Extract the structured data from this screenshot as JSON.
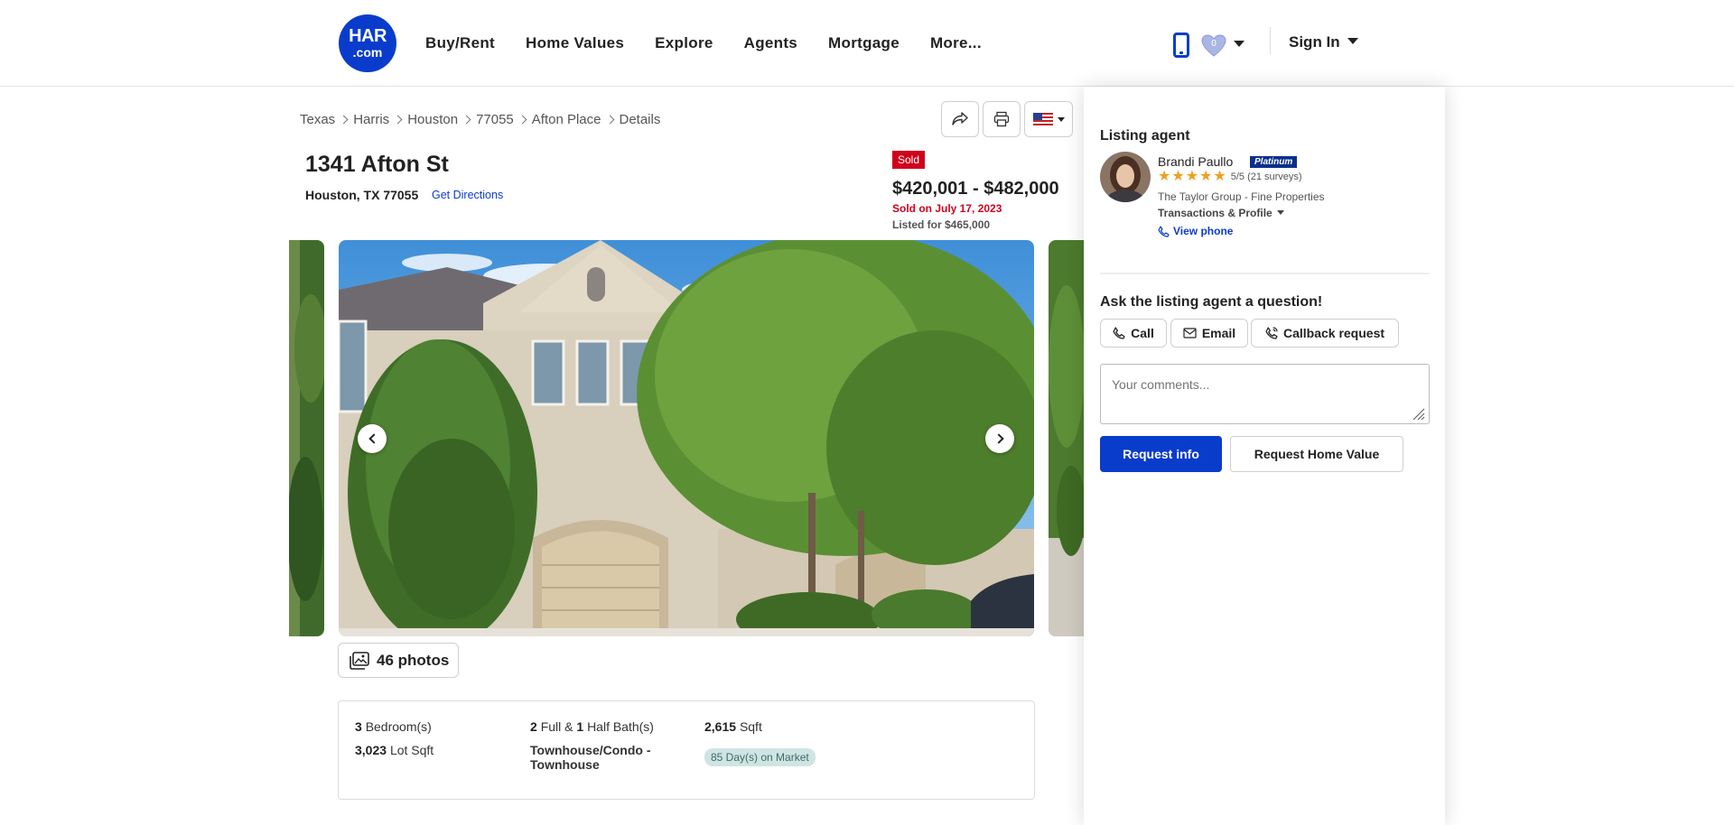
{
  "header": {
    "logo_top": "HAR",
    "logo_bottom": ".com",
    "nav": [
      "Buy/Rent",
      "Home Values",
      "Explore",
      "Agents",
      "Mortgage",
      "More..."
    ],
    "favorites_count": "0",
    "sign_in": "Sign In"
  },
  "breadcrumb": [
    "Texas",
    "Harris",
    "Houston",
    "77055",
    "Afton Place",
    "Details"
  ],
  "listing": {
    "address": "1341 Afton St",
    "city_line": "Houston, TX 77055",
    "directions": "Get Directions",
    "status_badge": "Sold",
    "price_range": "$420,001 - $482,000",
    "sold_on": "Sold on July 17, 2023",
    "listed_for": "Listed for $465,000"
  },
  "photos": {
    "button_label": "46 photos"
  },
  "facts": {
    "bedrooms_num": "3",
    "bedrooms_label": "Bedroom(s)",
    "lot_num": "3,023",
    "lot_label": "Lot Sqft",
    "full_baths": "2",
    "full_label": "Full &",
    "half_baths": "1",
    "half_label": "Half Bath(s)",
    "property_type": "Townhouse/Condo - Townhouse",
    "sqft_num": "2,615",
    "sqft_label": "Sqft",
    "days_on_market": "85 Day(s) on Market"
  },
  "agent_panel": {
    "title": "Listing agent",
    "agent_name": "Brandi Paullo",
    "tier_badge": "Platinum",
    "stars": 5,
    "rating_text": "5/5 (21 surveys)",
    "office": "The Taylor Group - Fine Properties",
    "transactions_link": "Transactions & Profile",
    "view_phone": "View phone",
    "ask_title": "Ask the listing agent a question!",
    "buttons": {
      "call": "Call",
      "email": "Email",
      "callback": "Callback request"
    },
    "comments_placeholder": "Your comments...",
    "request_info": "Request info",
    "request_value": "Request Home Value"
  },
  "colors": {
    "brand_blue": "#0a3ccc",
    "sold_red": "#d0021b",
    "star_orange": "#f0a020"
  },
  "icons": [
    "phone-icon",
    "heart-icon",
    "share-icon",
    "print-icon",
    "us-flag-icon",
    "chevron-left-icon",
    "chevron-right-icon",
    "gallery-icon",
    "star-icon",
    "phone-small-icon",
    "envelope-icon",
    "callback-icon",
    "resize-grip-icon"
  ]
}
